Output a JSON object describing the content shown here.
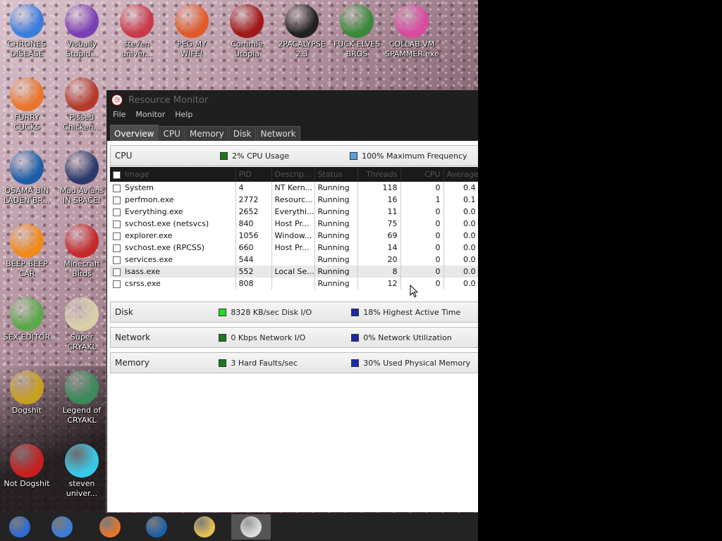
{
  "desktop": {
    "icons": [
      {
        "label": "CHRONES DISEASE",
        "icon": "chrome-icon",
        "color": "#3b7ddd"
      },
      {
        "label": "Visually Stupid...",
        "icon": "visual-studio-icon",
        "color": "#7b3fb5"
      },
      {
        "label": "steven univer...",
        "icon": "steven-universe-icon",
        "color": "#c83a4a"
      },
      {
        "label": "PEG MY WIFE!",
        "icon": "peggle-icon",
        "color": "#e05a2a"
      },
      {
        "label": "Commie Utopia",
        "icon": "commie-icon",
        "color": "#a01818"
      },
      {
        "label": "2PACALYPSE 2.3",
        "icon": "terminal-icon",
        "color": "#222222"
      },
      {
        "label": "FUCK ELVES BROS",
        "icon": "elf-icon",
        "color": "#3a8a3a"
      },
      {
        "label": "COLLAB VM SPAMMER.exe",
        "icon": "vm-icon",
        "color": "#d94aa0"
      },
      {
        "label": "FURRY CUCKS",
        "icon": "firefox-icon",
        "color": "#e8762b"
      },
      {
        "label": "Pissed Chicken...",
        "icon": "angry-birds-seasons-icon",
        "color": "#b33a2a"
      },
      {
        "label": "OSAMA BIN LADEN BR...",
        "icon": "obama-icon",
        "color": "#1b5fa8"
      },
      {
        "label": "Mad Avians IN SPACE!",
        "icon": "angry-birds-space-icon",
        "color": "#2b3a6a"
      },
      {
        "label": "BEEP BEEP CAR",
        "icon": "vlc-icon",
        "color": "#f08a1a"
      },
      {
        "label": "Minecraft Birds",
        "icon": "angry-birds-icon",
        "color": "#c42a2a"
      },
      {
        "label": "SEX EDITOR",
        "icon": "hxd-icon",
        "color": "#5aa84a"
      },
      {
        "label": "Super CRYAKL",
        "icon": "pixel-dog-icon",
        "color": "#d8d0a8"
      },
      {
        "label": "Dogshit",
        "icon": "cpp-icon",
        "color": "#c8a020"
      },
      {
        "label": "Legend of CRYAKL",
        "icon": "pixel-hero-icon",
        "color": "#3a8a5a"
      },
      {
        "label": "Not Dogshit",
        "icon": "devcpp-icon",
        "color": "#c82020"
      },
      {
        "label": "steven univer...",
        "icon": "gem-icon",
        "color": "#3ac8e8"
      }
    ]
  },
  "window": {
    "title": "Resource Monitor",
    "menu": [
      "File",
      "Monitor",
      "Help"
    ],
    "tabs": [
      "Overview",
      "CPU",
      "Memory",
      "Disk",
      "Network"
    ],
    "active_tab": "Overview",
    "cpu": {
      "name": "CPU",
      "metric1": "2% CPU Usage",
      "metric1_color": "#1a7a1a",
      "metric2": "100% Maximum Frequency",
      "metric2_color": "#5aa0e0",
      "columns": [
        "Image",
        "PID",
        "Descrip...",
        "Status",
        "Threads",
        "CPU",
        "Average..."
      ],
      "rows": [
        [
          "System",
          "4",
          "NT Kern...",
          "Running",
          "118",
          "0",
          "0.4"
        ],
        [
          "perfmon.exe",
          "2772",
          "Resourc...",
          "Running",
          "16",
          "1",
          "0.1"
        ],
        [
          "Everything.exe",
          "2652",
          "Everythi...",
          "Running",
          "11",
          "0",
          "0.0"
        ],
        [
          "svchost.exe (netsvcs)",
          "840",
          "Host Pr...",
          "Running",
          "75",
          "0",
          "0.0"
        ],
        [
          "explorer.exe",
          "1056",
          "Window...",
          "Running",
          "69",
          "0",
          "0.0"
        ],
        [
          "svchost.exe (RPCSS)",
          "660",
          "Host Pr...",
          "Running",
          "14",
          "0",
          "0.0"
        ],
        [
          "services.exe",
          "544",
          "",
          "Running",
          "20",
          "0",
          "0.0"
        ],
        [
          "lsass.exe",
          "552",
          "Local Se...",
          "Running",
          "8",
          "0",
          "0.0"
        ],
        [
          "csrss.exe",
          "808",
          "",
          "Running",
          "12",
          "0",
          "0.0"
        ]
      ]
    },
    "disk": {
      "name": "Disk",
      "metric1": "8328 KB/sec Disk I/O",
      "metric1_color": "#22dd22",
      "metric2": "18% Highest Active Time",
      "metric2_color": "#1a2aa8"
    },
    "network": {
      "name": "Network",
      "metric1": "0 Kbps Network I/O",
      "metric1_color": "#1a7a1a",
      "metric2": "0% Network Utilization",
      "metric2_color": "#1a2aa8"
    },
    "memory": {
      "name": "Memory",
      "metric1": "3 Hard Faults/sec",
      "metric1_color": "#1a7a1a",
      "metric2": "30% Used Physical Memory",
      "metric2_color": "#1a2aa8"
    }
  },
  "taskbar": {
    "items": [
      {
        "icon": "chrome-canary-icon",
        "color": "#2a6ad8"
      },
      {
        "icon": "chrome-icon",
        "color": "#3b7ddd"
      },
      {
        "icon": "firefox-icon",
        "color": "#e8762b"
      },
      {
        "icon": "obama-icon",
        "color": "#1b5fa8"
      },
      {
        "icon": "file-explorer-icon",
        "color": "#e8c050"
      },
      {
        "icon": "resource-monitor-icon",
        "color": "#dddddd"
      }
    ]
  }
}
